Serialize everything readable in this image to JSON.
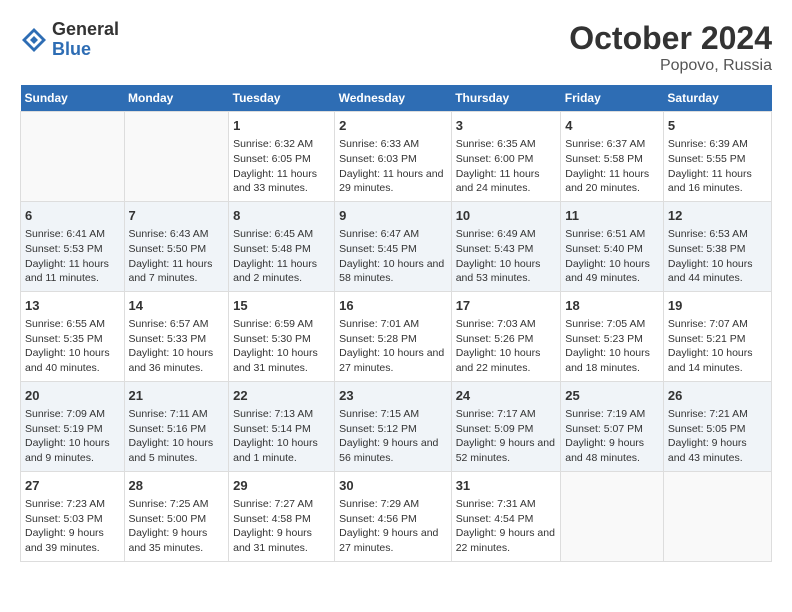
{
  "header": {
    "logo_general": "General",
    "logo_blue": "Blue",
    "month_title": "October 2024",
    "location": "Popovo, Russia"
  },
  "weekdays": [
    "Sunday",
    "Monday",
    "Tuesday",
    "Wednesday",
    "Thursday",
    "Friday",
    "Saturday"
  ],
  "weeks": [
    [
      {
        "day": "",
        "info": ""
      },
      {
        "day": "",
        "info": ""
      },
      {
        "day": "1",
        "info": "Sunrise: 6:32 AM\nSunset: 6:05 PM\nDaylight: 11 hours and 33 minutes."
      },
      {
        "day": "2",
        "info": "Sunrise: 6:33 AM\nSunset: 6:03 PM\nDaylight: 11 hours and 29 minutes."
      },
      {
        "day": "3",
        "info": "Sunrise: 6:35 AM\nSunset: 6:00 PM\nDaylight: 11 hours and 24 minutes."
      },
      {
        "day": "4",
        "info": "Sunrise: 6:37 AM\nSunset: 5:58 PM\nDaylight: 11 hours and 20 minutes."
      },
      {
        "day": "5",
        "info": "Sunrise: 6:39 AM\nSunset: 5:55 PM\nDaylight: 11 hours and 16 minutes."
      }
    ],
    [
      {
        "day": "6",
        "info": "Sunrise: 6:41 AM\nSunset: 5:53 PM\nDaylight: 11 hours and 11 minutes."
      },
      {
        "day": "7",
        "info": "Sunrise: 6:43 AM\nSunset: 5:50 PM\nDaylight: 11 hours and 7 minutes."
      },
      {
        "day": "8",
        "info": "Sunrise: 6:45 AM\nSunset: 5:48 PM\nDaylight: 11 hours and 2 minutes."
      },
      {
        "day": "9",
        "info": "Sunrise: 6:47 AM\nSunset: 5:45 PM\nDaylight: 10 hours and 58 minutes."
      },
      {
        "day": "10",
        "info": "Sunrise: 6:49 AM\nSunset: 5:43 PM\nDaylight: 10 hours and 53 minutes."
      },
      {
        "day": "11",
        "info": "Sunrise: 6:51 AM\nSunset: 5:40 PM\nDaylight: 10 hours and 49 minutes."
      },
      {
        "day": "12",
        "info": "Sunrise: 6:53 AM\nSunset: 5:38 PM\nDaylight: 10 hours and 44 minutes."
      }
    ],
    [
      {
        "day": "13",
        "info": "Sunrise: 6:55 AM\nSunset: 5:35 PM\nDaylight: 10 hours and 40 minutes."
      },
      {
        "day": "14",
        "info": "Sunrise: 6:57 AM\nSunset: 5:33 PM\nDaylight: 10 hours and 36 minutes."
      },
      {
        "day": "15",
        "info": "Sunrise: 6:59 AM\nSunset: 5:30 PM\nDaylight: 10 hours and 31 minutes."
      },
      {
        "day": "16",
        "info": "Sunrise: 7:01 AM\nSunset: 5:28 PM\nDaylight: 10 hours and 27 minutes."
      },
      {
        "day": "17",
        "info": "Sunrise: 7:03 AM\nSunset: 5:26 PM\nDaylight: 10 hours and 22 minutes."
      },
      {
        "day": "18",
        "info": "Sunrise: 7:05 AM\nSunset: 5:23 PM\nDaylight: 10 hours and 18 minutes."
      },
      {
        "day": "19",
        "info": "Sunrise: 7:07 AM\nSunset: 5:21 PM\nDaylight: 10 hours and 14 minutes."
      }
    ],
    [
      {
        "day": "20",
        "info": "Sunrise: 7:09 AM\nSunset: 5:19 PM\nDaylight: 10 hours and 9 minutes."
      },
      {
        "day": "21",
        "info": "Sunrise: 7:11 AM\nSunset: 5:16 PM\nDaylight: 10 hours and 5 minutes."
      },
      {
        "day": "22",
        "info": "Sunrise: 7:13 AM\nSunset: 5:14 PM\nDaylight: 10 hours and 1 minute."
      },
      {
        "day": "23",
        "info": "Sunrise: 7:15 AM\nSunset: 5:12 PM\nDaylight: 9 hours and 56 minutes."
      },
      {
        "day": "24",
        "info": "Sunrise: 7:17 AM\nSunset: 5:09 PM\nDaylight: 9 hours and 52 minutes."
      },
      {
        "day": "25",
        "info": "Sunrise: 7:19 AM\nSunset: 5:07 PM\nDaylight: 9 hours and 48 minutes."
      },
      {
        "day": "26",
        "info": "Sunrise: 7:21 AM\nSunset: 5:05 PM\nDaylight: 9 hours and 43 minutes."
      }
    ],
    [
      {
        "day": "27",
        "info": "Sunrise: 7:23 AM\nSunset: 5:03 PM\nDaylight: 9 hours and 39 minutes."
      },
      {
        "day": "28",
        "info": "Sunrise: 7:25 AM\nSunset: 5:00 PM\nDaylight: 9 hours and 35 minutes."
      },
      {
        "day": "29",
        "info": "Sunrise: 7:27 AM\nSunset: 4:58 PM\nDaylight: 9 hours and 31 minutes."
      },
      {
        "day": "30",
        "info": "Sunrise: 7:29 AM\nSunset: 4:56 PM\nDaylight: 9 hours and 27 minutes."
      },
      {
        "day": "31",
        "info": "Sunrise: 7:31 AM\nSunset: 4:54 PM\nDaylight: 9 hours and 22 minutes."
      },
      {
        "day": "",
        "info": ""
      },
      {
        "day": "",
        "info": ""
      }
    ]
  ]
}
